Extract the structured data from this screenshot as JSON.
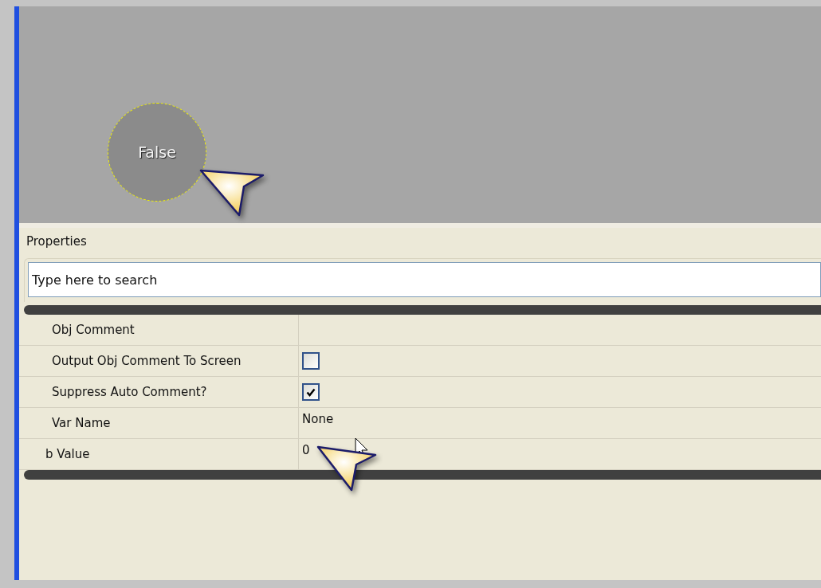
{
  "canvas": {
    "node": {
      "label": "False"
    }
  },
  "properties": {
    "title": "Properties",
    "search": {
      "placeholder": "Type here to search"
    },
    "rows": [
      {
        "kind": "text",
        "label": "Obj Comment"
      },
      {
        "kind": "checkbox",
        "label": "Output Obj Comment To Screen",
        "checked": false
      },
      {
        "kind": "checkbox",
        "label": "Suppress Auto Comment?",
        "checked": true
      },
      {
        "kind": "text",
        "label": "Var Name",
        "value": "None"
      },
      {
        "kind": "text",
        "label": "b Value",
        "value": "0"
      }
    ]
  }
}
